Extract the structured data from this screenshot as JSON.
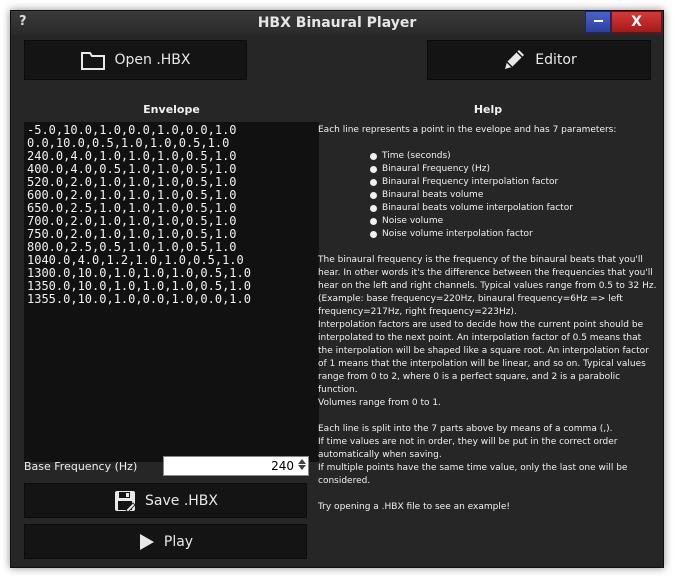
{
  "titlebar": {
    "help": "?",
    "title": "HBX Binaural Player",
    "minimize": "–",
    "close": "X"
  },
  "toolbar": {
    "open_label": "Open .HBX",
    "editor_label": "Editor"
  },
  "envelope": {
    "title": "Envelope",
    "lines": [
      "-5.0,10.0,1.0,0.0,1.0,0.0,1.0",
      "0.0,10.0,0.5,1.0,1.0,0.5,1.0",
      "240.0,4.0,1.0,1.0,1.0,0.5,1.0",
      "400.0,4.0,0.5,1.0,1.0,0.5,1.0",
      "520.0,2.0,1.0,1.0,1.0,0.5,1.0",
      "600.0,2.0,1.0,1.0,1.0,0.5,1.0",
      "650.0,2.5,1.0,1.0,1.0,0.5,1.0",
      "700.0,2.0,1.0,1.0,1.0,0.5,1.0",
      "750.0,2.0,1.0,1.0,1.0,0.5,1.0",
      "800.0,2.5,0.5,1.0,1.0,0.5,1.0",
      "1040.0,4.0,1.2,1.0,1.0,0.5,1.0",
      "1300.0,10.0,1.0,1.0,1.0,0.5,1.0",
      "1350.0,10.0,1.0,1.0,1.0,0.5,1.0",
      "1355.0,10.0,1.0,0.0,1.0,0.0,1.0"
    ]
  },
  "help": {
    "title": "Help",
    "intro": "Each line represents a point in the evelope and has 7 parameters:",
    "params": [
      "Time (seconds)",
      "Binaural Frequency (Hz)",
      "Binaural Frequency interpolation factor",
      "Binaural beats volume",
      "Binaural beats volume interpolation factor",
      "Noise volume",
      "Noise volume interpolation factor"
    ],
    "para1": "The binaural frequency is the frequency of the binaural beats that you'll hear. In other words it's the difference between the frequencies that you'll hear on the left and right channels. Typical values range from 0.5 to 32 Hz. (Example: base frequency=220Hz, binaural frequency=6Hz => left frequency=217Hz, right frequency=223Hz).",
    "para2": "Interpolation factors are used to decide how the current point should be interpolated to the next point. An interpolation factor of 0.5 means that the interpolation will be shaped like a square root. An interpolation factor of 1 means that the interpolation will be linear, and so on. Typical values range from 0 to 2, where 0 is a perfect square, and 2 is a parabolic function.",
    "para3": "Volumes range from 0 to 1.",
    "para4": "Each line is split into the 7 parts above by means of a comma (,).",
    "para5": "If time values are not in order, they will be put in the correct order automatically when saving.",
    "para6": "If multiple points have the same time value, only the last one will be considered.",
    "para7": "Try opening a .HBX file to see an example!"
  },
  "base_frequency": {
    "label": "Base Frequency (Hz)",
    "value": "240"
  },
  "actions": {
    "save_label": "Save .HBX",
    "play_label": "Play"
  }
}
